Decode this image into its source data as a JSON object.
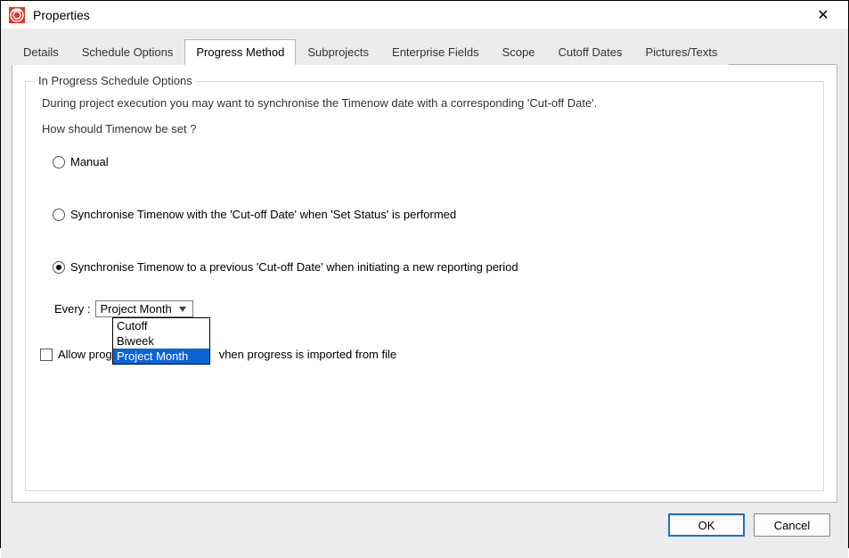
{
  "window": {
    "title": "Properties",
    "close_glyph": "✕"
  },
  "tabs": [
    {
      "label": "Details"
    },
    {
      "label": "Schedule Options"
    },
    {
      "label": "Progress Method"
    },
    {
      "label": "Subprojects"
    },
    {
      "label": "Enterprise Fields"
    },
    {
      "label": "Scope"
    },
    {
      "label": "Cutoff Dates"
    },
    {
      "label": "Pictures/Texts"
    }
  ],
  "group": {
    "title": "In Progress Schedule Options",
    "intro": "During project execution you may want to synchronise the Timenow date with a corresponding 'Cut-off Date'.",
    "question": "How should Timenow be set ?",
    "radios": {
      "manual": "Manual",
      "sync_set_status": "Synchronise Timenow with the 'Cut-off Date' when 'Set Status' is performed",
      "sync_previous": "Synchronise Timenow to a previous 'Cut-off Date' when initiating a new reporting period"
    },
    "every_label": "Every :",
    "every_value": "Project Month",
    "every_options": [
      "Cutoff",
      "Biweek",
      "Project Month"
    ],
    "checkbox_label_before": "Allow prog",
    "checkbox_label_after": "vhen progress is imported from file"
  },
  "footer": {
    "ok": "OK",
    "cancel": "Cancel"
  }
}
